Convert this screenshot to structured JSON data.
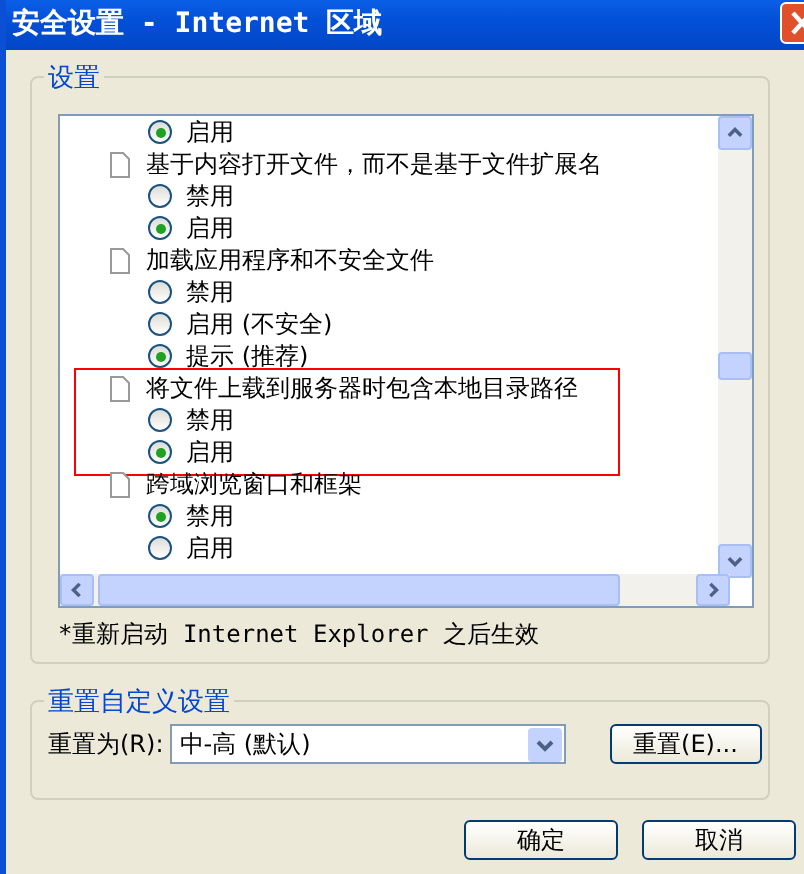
{
  "window": {
    "title": "安全设置 - Internet 区域"
  },
  "settings_group": {
    "label": "设置",
    "groups": [
      {
        "options": [
          {
            "label": "启用",
            "selected": true
          }
        ],
        "highlighted": false
      },
      {
        "title": "基于内容打开文件，而不是基于文件扩展名",
        "highlighted": false,
        "options": [
          {
            "label": "禁用",
            "selected": false
          },
          {
            "label": "启用",
            "selected": true
          }
        ]
      },
      {
        "title": "加载应用程序和不安全文件",
        "highlighted": false,
        "options": [
          {
            "label": "禁用",
            "selected": false
          },
          {
            "label": "启用 (不安全)",
            "selected": false
          },
          {
            "label": "提示 (推荐)",
            "selected": true
          }
        ]
      },
      {
        "title": "将文件上载到服务器时包含本地目录路径",
        "highlighted": true,
        "options": [
          {
            "label": "禁用",
            "selected": false
          },
          {
            "label": "启用",
            "selected": true
          }
        ]
      },
      {
        "title": "跨域浏览窗口和框架",
        "highlighted": false,
        "options": [
          {
            "label": "禁用",
            "selected": true
          },
          {
            "label": "启用",
            "selected": false
          }
        ]
      }
    ],
    "note": "*重新启动 Internet Explorer 之后生效"
  },
  "reset_group": {
    "label": "重置自定义设置",
    "field_label": "重置为(R):",
    "value": "中-高 (默认)",
    "button": "重置(E)..."
  },
  "buttons": [
    "确定",
    "取消"
  ]
}
